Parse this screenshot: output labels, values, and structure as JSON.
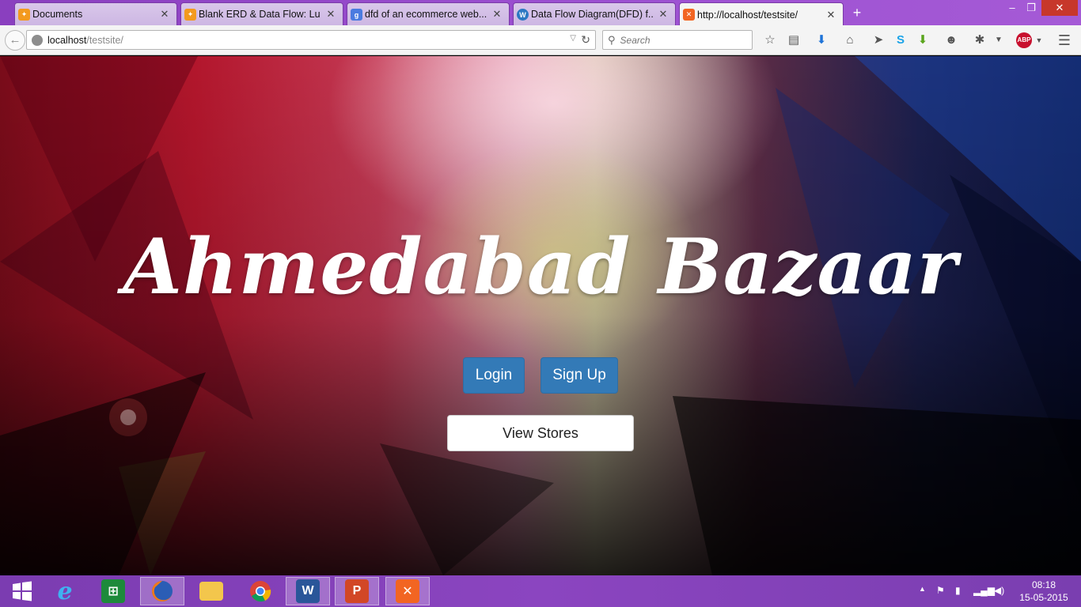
{
  "browser": {
    "tabs": [
      {
        "title": "Documents",
        "icon": "lucidchart-icon",
        "color": "#f39a1e"
      },
      {
        "title": "Blank ERD & Data Flow: Lu...",
        "icon": "lucidchart-icon",
        "color": "#f39a1e"
      },
      {
        "title": "dfd of an ecommerce web...",
        "icon": "google-icon",
        "color": "#4a7be0"
      },
      {
        "title": "Data Flow Diagram(DFD) f...",
        "icon": "wordpress-icon",
        "color": "#2b78c2"
      },
      {
        "title": "http://localhost/testsite/",
        "icon": "xampp-icon",
        "color": "#f26522",
        "active": true
      }
    ],
    "new_tab_symbol": "+",
    "window_controls": {
      "minimize": "–",
      "restore": "❐",
      "close": "✕"
    },
    "url": {
      "host": "localhost",
      "path": "/testsite/"
    },
    "search": {
      "placeholder": "Search"
    },
    "toolbar_icons": [
      "bookmark-star-icon",
      "reading-list-icon",
      "download-icon",
      "home-icon",
      "send-icon",
      "skype-icon",
      "downloader-icon",
      "chat-icon",
      "extension-icon",
      "adblock-plus-icon",
      "menu-icon"
    ],
    "adblock_label": "ABP"
  },
  "page": {
    "title": "Ahmedabad Bazaar",
    "buttons": {
      "login": "Login",
      "signup": "Sign Up",
      "view_stores": "View Stores"
    },
    "colors": {
      "primary_button": "#337ab7"
    }
  },
  "taskbar": {
    "apps": [
      "start-icon",
      "internet-explorer-icon",
      "store-icon",
      "firefox-icon",
      "file-explorer-icon",
      "chrome-icon",
      "word-icon",
      "powerpoint-icon",
      "xampp-icon"
    ],
    "word_letter": "W",
    "powerpoint_letter": "P",
    "clock": {
      "time": "08:18",
      "date": "15-05-2015"
    }
  }
}
